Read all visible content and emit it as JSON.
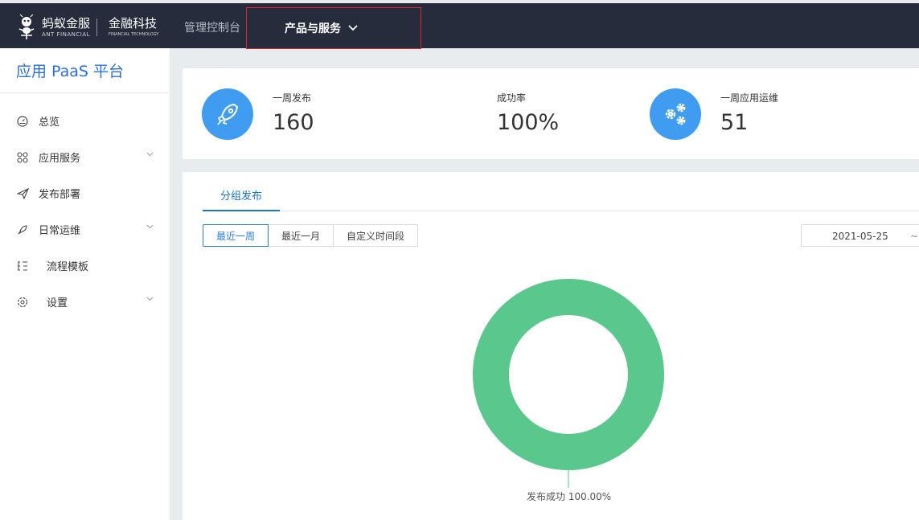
{
  "header": {
    "logo_cn": "蚂蚁金服",
    "logo_en": "ANT FINANCIAL",
    "logo_tech_cn": "金融科技",
    "logo_tech_en": "FINANCIAL TECHNOLOGY",
    "nav_console": "管理控制台",
    "nav_products": "产品与服务"
  },
  "sidebar": {
    "title": "应用 PaaS 平台",
    "items": [
      {
        "label": "总览",
        "icon": "dashboard-icon",
        "has_children": false
      },
      {
        "label": "应用服务",
        "icon": "apps-icon",
        "has_children": true
      },
      {
        "label": "发布部署",
        "icon": "paper-plane-icon",
        "has_children": false
      },
      {
        "label": "日常运维",
        "icon": "rocket-icon",
        "has_children": true
      },
      {
        "label": "流程模板",
        "icon": "flow-list-icon",
        "has_children": false
      },
      {
        "label": "设置",
        "icon": "gear-icon",
        "has_children": true
      }
    ]
  },
  "stats": {
    "weekly_releases": {
      "label": "一周发布",
      "value": "160",
      "icon": "rocket-icon"
    },
    "success_rate": {
      "label": "成功率",
      "value": "100%"
    },
    "weekly_ops": {
      "label": "一周应用运维",
      "value": "51",
      "icon": "gears-icon"
    }
  },
  "main": {
    "tab": "分组发布",
    "ranges": [
      "最近一周",
      "最近一月",
      "自定义时间段"
    ],
    "active_range": "最近一周",
    "date_start": "2021-05-25",
    "date_separator": "~"
  },
  "colors": {
    "accent": "#3f9cf1",
    "success": "#5ac78c",
    "header_bg": "#262c3c"
  },
  "chart_data": {
    "type": "pie",
    "categories": [
      "发布成功"
    ],
    "values": [
      100
    ],
    "data_labels": [
      "发布成功 100.00%"
    ]
  }
}
